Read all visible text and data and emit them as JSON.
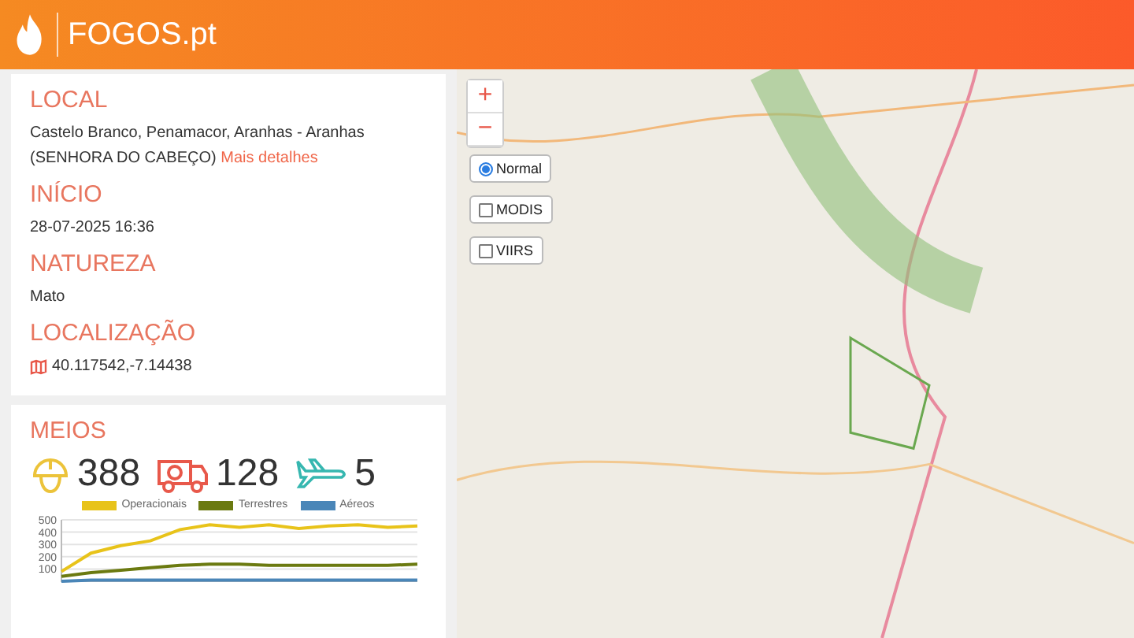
{
  "header": {
    "logo": "FOGOS.pt"
  },
  "details": [
    {
      "heading": "LOCAL",
      "text": "Castelo Branco, Penamacor, Aranhas - Aranhas (SENHORA DO CABEÇO)",
      "link": "Mais detalhes"
    },
    {
      "heading": "INÍCIO",
      "text": "28-07-2025 16:36"
    },
    {
      "heading": "NATUREZA",
      "text": "Mato"
    },
    {
      "heading": "LOCALIZAÇÃO",
      "text": "40.117542,-7.14438",
      "kind": "coords"
    }
  ],
  "meios": {
    "heading": "MEIOS",
    "counts": [
      {
        "kind": "firefighter",
        "value": "388"
      },
      {
        "kind": "truck",
        "value": "128"
      },
      {
        "kind": "plane",
        "value": "5"
      }
    ],
    "chart_data": {
      "type": "line",
      "yticks": [
        100,
        200,
        300,
        400,
        500
      ],
      "ylim": [
        0,
        500
      ],
      "grid": true,
      "series": [
        {
          "name": "Operacionais",
          "color": "#e8c31a",
          "values": [
            80,
            230,
            290,
            330,
            420,
            460,
            440,
            460,
            430,
            450,
            460,
            440,
            450
          ]
        },
        {
          "name": "Terrestres",
          "color": "#6b7a10",
          "values": [
            40,
            70,
            90,
            110,
            130,
            140,
            140,
            130,
            130,
            130,
            130,
            130,
            140
          ]
        },
        {
          "name": "Aéreos",
          "color": "#4a86b8",
          "values": [
            0,
            10,
            10,
            10,
            10,
            10,
            10,
            10,
            10,
            10,
            10,
            10,
            10
          ]
        }
      ]
    }
  },
  "map": {
    "layers": [
      {
        "label": "Normal",
        "kind": "radio",
        "selected": true
      },
      {
        "label": "MODIS",
        "kind": "checkbox",
        "selected": false
      },
      {
        "label": "VIIRS",
        "kind": "checkbox",
        "selected": false
      }
    ],
    "zoom_in": "+",
    "zoom_out": "−"
  }
}
